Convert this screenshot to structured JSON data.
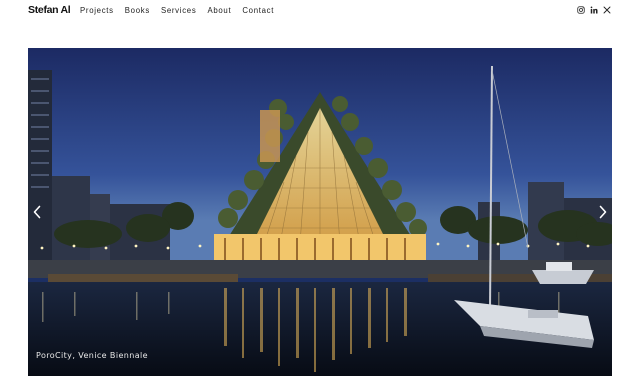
{
  "brand": {
    "logo_text": "Stefan Al"
  },
  "nav": {
    "items": [
      {
        "label": "Projects"
      },
      {
        "label": "Books"
      },
      {
        "label": "Services"
      },
      {
        "label": "About"
      },
      {
        "label": "Contact"
      }
    ]
  },
  "social": {
    "icons": [
      "instagram-icon",
      "linkedin-icon",
      "x-icon"
    ]
  },
  "slideshow": {
    "caption": "PoroCity, Venice Biennale",
    "controls": [
      "chevron-left-icon",
      "chevron-right-icon"
    ]
  },
  "colors": {
    "sky_top": "#1d2c66",
    "sky_bottom": "#4a6fa8",
    "water": "#0d1624",
    "warm_light": "#f5d27a",
    "foliage": "#3b4a2a"
  }
}
